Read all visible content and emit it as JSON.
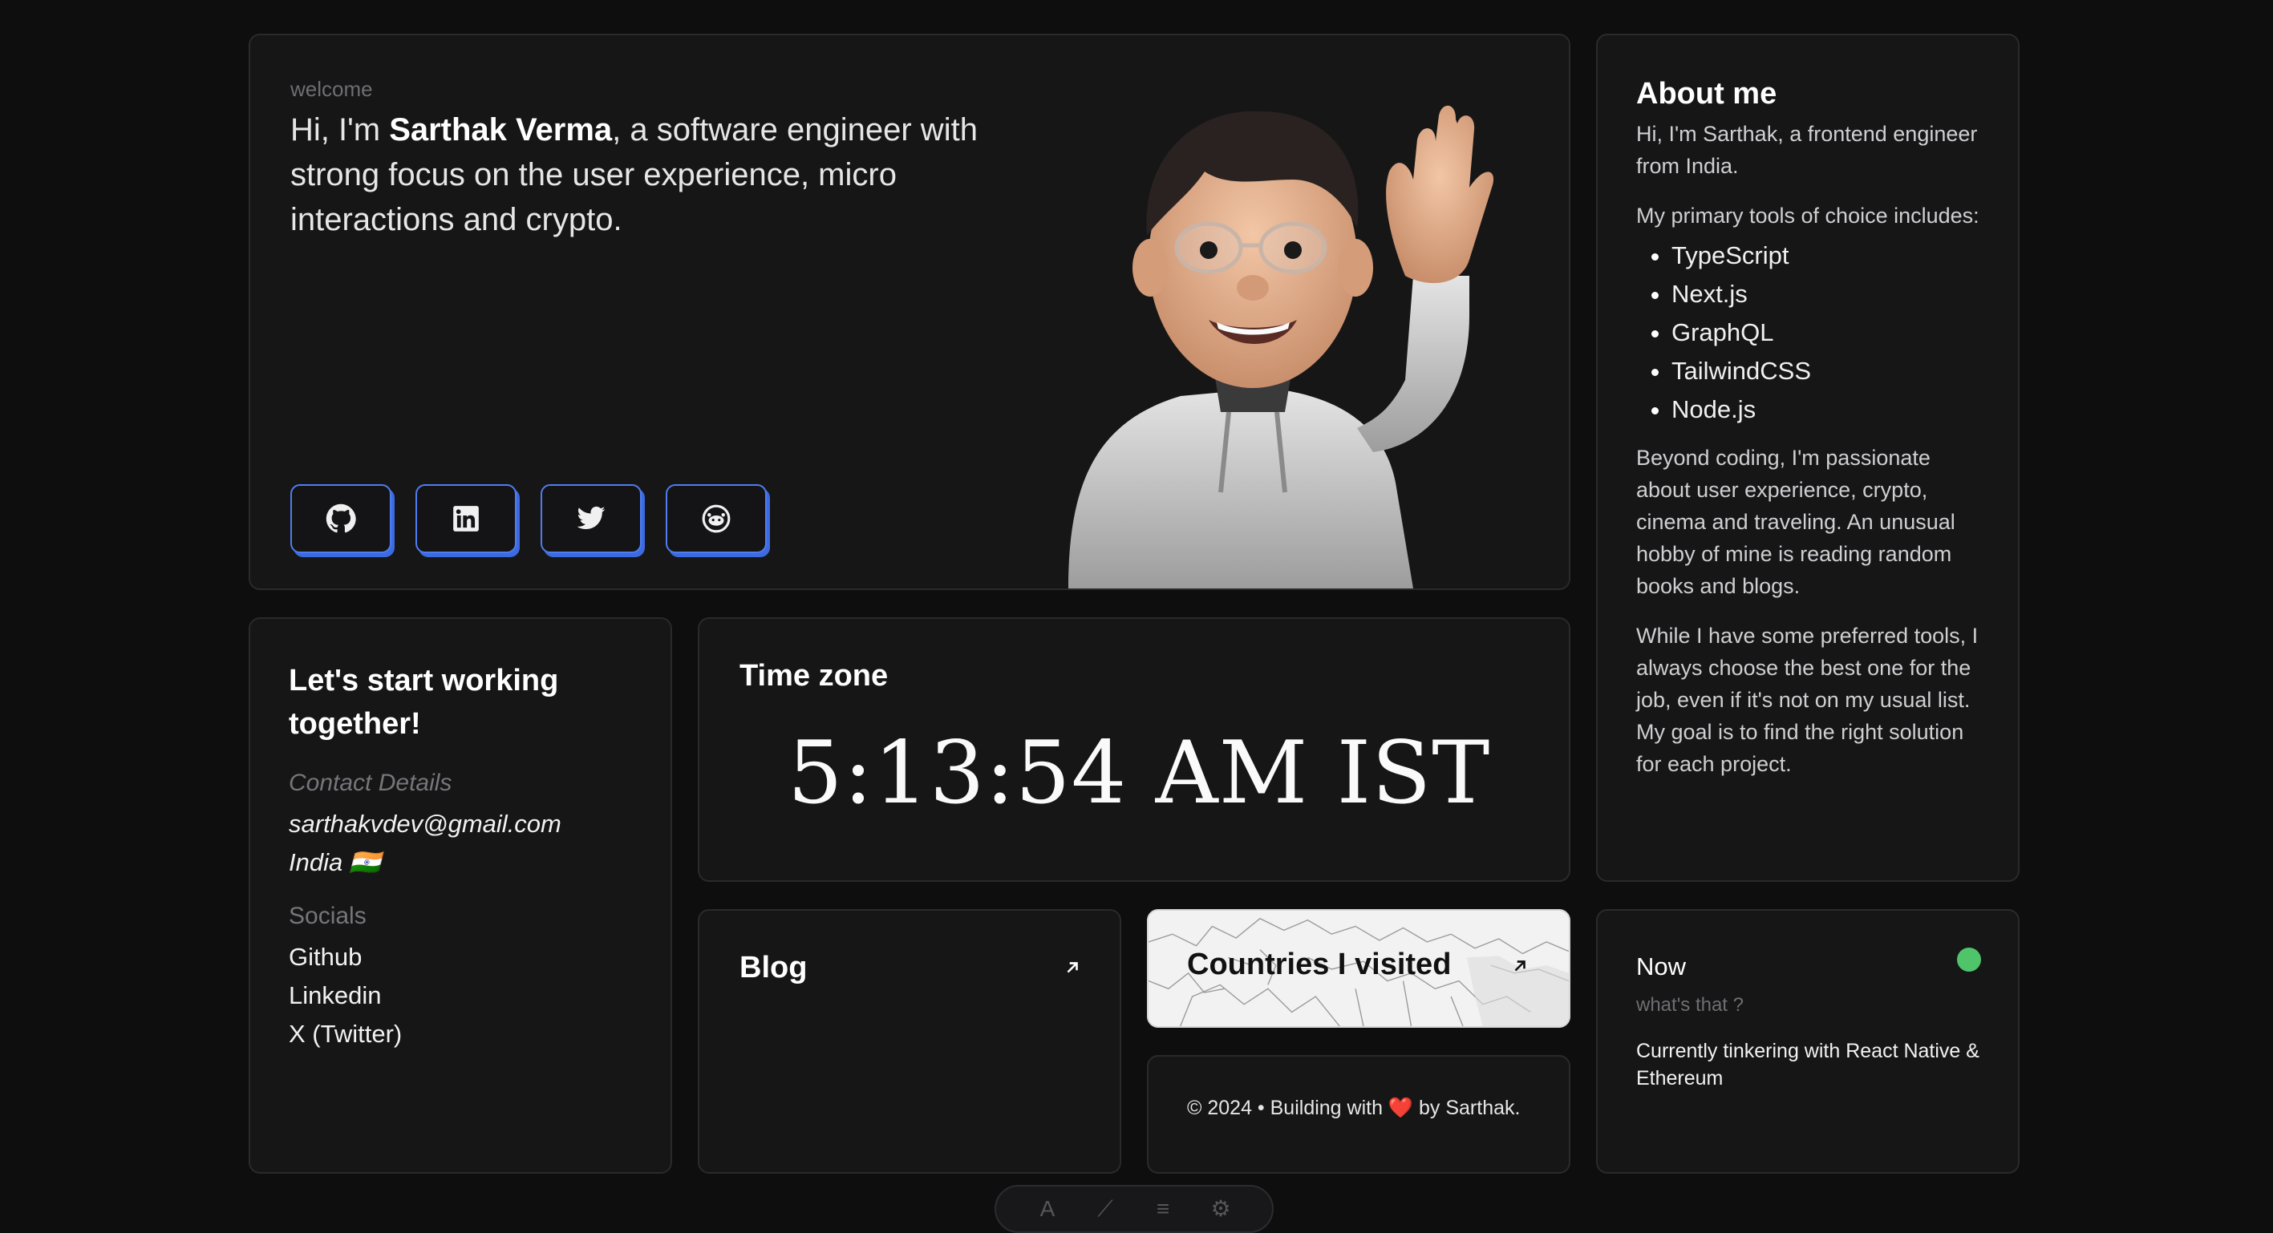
{
  "hero": {
    "welcome": "welcome",
    "intro_prefix": "Hi, I'm ",
    "name": "Sarthak Verma",
    "intro_suffix": ", a software engineer with strong focus on the user experience, micro interactions and crypto.",
    "socials": [
      "github-icon",
      "linkedin-icon",
      "twitter-icon",
      "reddit-icon"
    ]
  },
  "about": {
    "title": "About me",
    "p1": "Hi, I'm Sarthak, a frontend engineer from India.",
    "p2": "My primary tools of choice includes:",
    "tools": [
      "TypeScript",
      "Next.js",
      "GraphQL",
      "TailwindCSS",
      "Node.js"
    ],
    "p3": "Beyond coding, I'm passionate about user experience, crypto, cinema and traveling. An unusual hobby of mine is reading random books and blogs.",
    "p4": "While I have some preferred tools, I always choose the best one for the job, even if it's not on my usual list. My goal is to find the right solution for each project."
  },
  "contact": {
    "title": "Let's start working together!",
    "details_label": "Contact Details",
    "email": "sarthakvdev@gmail.com",
    "country": "India 🇮🇳",
    "socials_label": "Socials",
    "links": [
      "Github",
      "Linkedin",
      "X (Twitter)"
    ]
  },
  "timezone": {
    "title": "Time zone",
    "time": "5:13:54 AM IST"
  },
  "blog": {
    "title": "Blog"
  },
  "countries": {
    "title": "Countries I visited"
  },
  "footer": {
    "text": "© 2024 • Building with ❤️ by Sarthak."
  },
  "now": {
    "title": "Now",
    "subtitle": "what's that ?",
    "text": "Currently tinkering with React Native & Ethereum",
    "status_color": "#4fc46a"
  },
  "colors": {
    "accent": "#4f7df0",
    "background": "#0e0e0f",
    "card": "#161617"
  }
}
